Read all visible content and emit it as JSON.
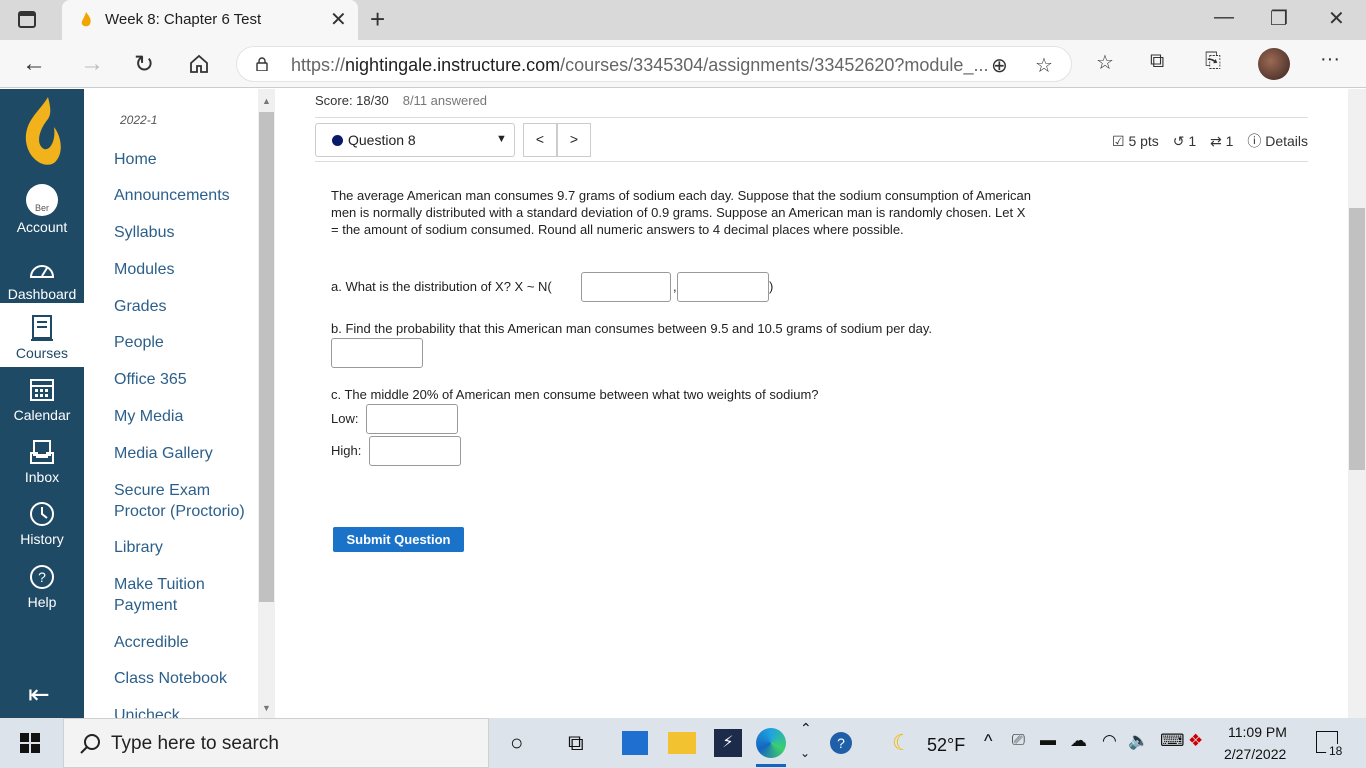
{
  "browser": {
    "tab_title": "Week 8: Chapter 6 Test",
    "url_prefix": "https://",
    "url_host": "nightingale.instructure.com",
    "url_path": "/courses/3345304/assignments/33452620?module_..."
  },
  "global_nav": {
    "items": [
      {
        "label": "Account",
        "icon": "account-avatar-icon"
      },
      {
        "label": "Dashboard",
        "icon": "dashboard-icon"
      },
      {
        "label": "Courses",
        "icon": "courses-icon"
      },
      {
        "label": "Calendar",
        "icon": "calendar-icon"
      },
      {
        "label": "Inbox",
        "icon": "inbox-icon"
      },
      {
        "label": "History",
        "icon": "history-icon"
      },
      {
        "label": "Help",
        "icon": "help-icon"
      }
    ],
    "active": "Courses",
    "avatar_alt": "Ber"
  },
  "course_nav": {
    "term": "2022-1",
    "items": [
      "Home",
      "Announcements",
      "Syllabus",
      "Modules",
      "Grades",
      "People",
      "Office 365",
      "My Media",
      "Media Gallery",
      "Secure Exam Proctor (Proctorio)",
      "Library",
      "Make Tuition Payment",
      "Accredible",
      "Class Notebook",
      "Unicheck"
    ]
  },
  "quiz": {
    "score": "Score: 18/30",
    "answered": "8/11 answered",
    "question_label": "Question 8",
    "prev": "<",
    "next": ">",
    "points": "5 pts",
    "retries": "1",
    "attempts": "1",
    "details": "Details",
    "question_text": "The average American man consumes 9.7 grams of sodium each day. Suppose that the sodium consumption of American men is normally distributed with a standard deviation of 0.9 grams. Suppose an American man is randomly chosen. Let X = the amount of sodium consumed. Round all numeric answers to 4 decimal places where possible.",
    "part_a": "a. What is the distribution of X? X ~ N(",
    "part_a_comma": ",",
    "part_a_close": ")",
    "part_b": "b. Find the probability that this American man consumes between 9.5 and 10.5 grams of sodium per day.",
    "part_c": "c. The middle 20% of American men consume between what two weights of sodium?",
    "low_label": "Low:",
    "high_label": "High:",
    "submit_label": "Submit Question"
  },
  "taskbar": {
    "search_placeholder": "Type here to search",
    "temperature": "52°F",
    "time": "11:09 PM",
    "date": "2/27/2022",
    "notifications": "18"
  },
  "colors": {
    "global_nav_bg": "#1f4a66",
    "link": "#2b5f8a",
    "submit_bg": "#1a73c9"
  }
}
